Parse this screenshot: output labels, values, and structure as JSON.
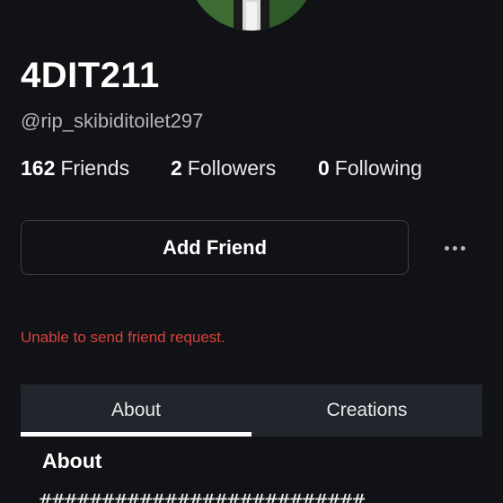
{
  "profile": {
    "display_name": "4DIT211",
    "username": "@rip_skibiditoilet297"
  },
  "stats": {
    "friends": {
      "count": "162",
      "label": "Friends"
    },
    "followers": {
      "count": "2",
      "label": "Followers"
    },
    "following": {
      "count": "0",
      "label": "Following"
    }
  },
  "actions": {
    "add_friend_label": "Add Friend",
    "more_icon": "more-horizontal-icon"
  },
  "error": {
    "message": "Unable to send friend request."
  },
  "tabs": [
    {
      "label": "About",
      "active": true
    },
    {
      "label": "Creations",
      "active": false
    }
  ],
  "about": {
    "title": "About",
    "body": "##########################"
  },
  "colors": {
    "background": "#111216",
    "error": "#d5433a",
    "tab_bar": "#22252b",
    "muted_text": "#b3b5b9"
  }
}
